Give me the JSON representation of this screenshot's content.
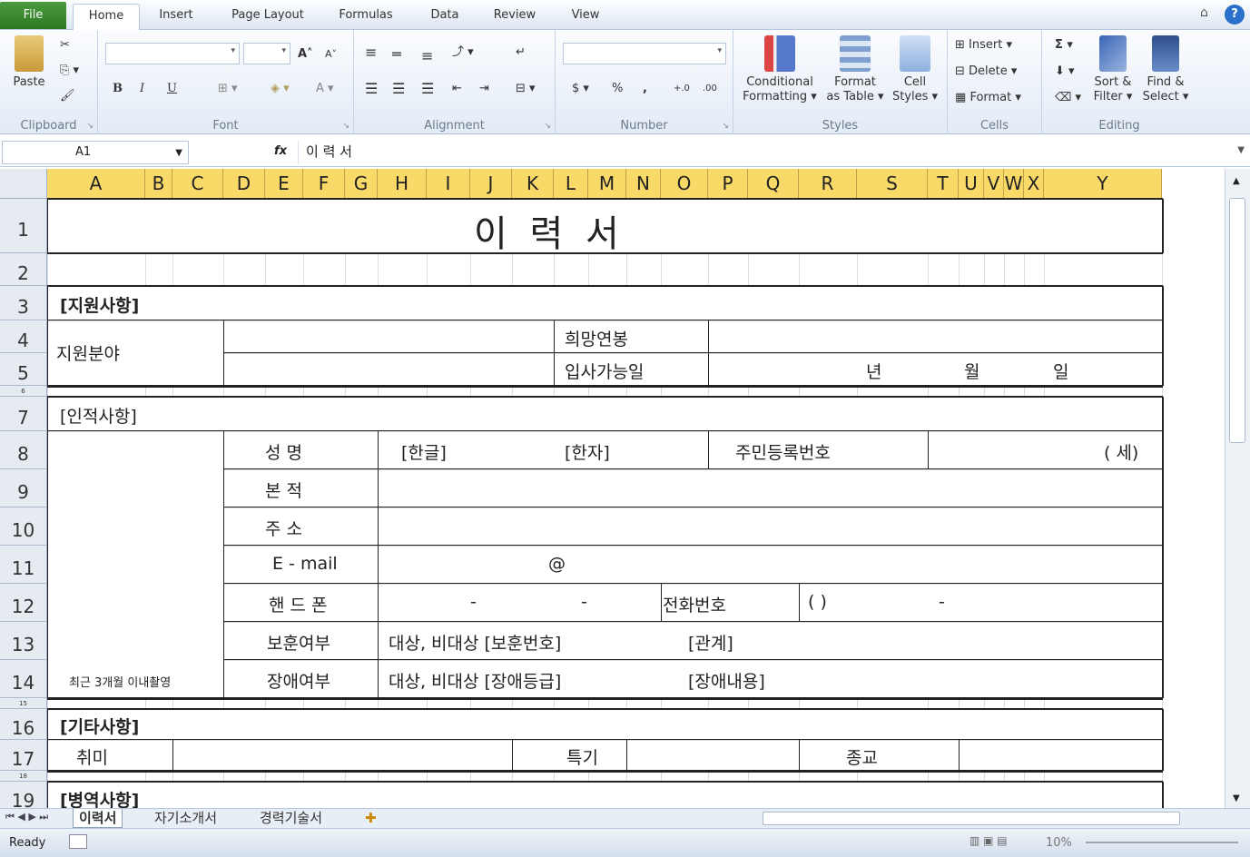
{
  "ribbon_tabs": {
    "file": "File",
    "home": "Home",
    "insert": "Insert",
    "page_layout": "Page Layout",
    "formulas": "Formulas",
    "data": "Data",
    "review": "Review",
    "view": "View"
  },
  "window": {
    "help": "?",
    "minimize": "⌂"
  },
  "clipboard": {
    "paste": "Paste",
    "label": "Clipboard"
  },
  "font_group": {
    "label": "Font",
    "bold": "B",
    "italic": "I",
    "underline": "U",
    "grow": "A˄",
    "shrink": "A˅",
    "color": "A"
  },
  "alignment": {
    "label": "Alignment"
  },
  "number_group": {
    "label": "Number",
    "currency": "$",
    "percent": "%",
    "comma": ","
  },
  "styles": {
    "label": "Styles",
    "conditional_1": "Conditional",
    "conditional_2": "Formatting ▾",
    "format_table_1": "Format",
    "format_table_2": "as Table ▾",
    "cell_styles_1": "Cell",
    "cell_styles_2": "Styles ▾"
  },
  "cells_group": {
    "label": "Cells",
    "insert": "Insert ▾",
    "delete": "Delete ▾",
    "format": "Format ▾"
  },
  "editing": {
    "label": "Editing",
    "sigma": "Σ ▾",
    "sort_1": "Sort &",
    "sort_2": "Filter ▾",
    "find_1": "Find &",
    "find_2": "Select ▾"
  },
  "formula_bar": {
    "name_box": "A1",
    "fx": "fx",
    "formula": "이 력 서"
  },
  "columns": [
    "A",
    "B",
    "C",
    "D",
    "E",
    "F",
    "G",
    "H",
    "I",
    "J",
    "K",
    "L",
    "M",
    "N",
    "O",
    "P",
    "Q",
    "R",
    "S",
    "T",
    "U",
    "V",
    "W",
    "X",
    "Y"
  ],
  "rows": [
    "1",
    "2",
    "3",
    "4",
    "5",
    "6",
    "7",
    "8",
    "9",
    "10",
    "11",
    "12",
    "13",
    "14",
    "15",
    "16",
    "17",
    "18",
    "19"
  ],
  "sheet": {
    "title": "이   력   서",
    "sec_apply": "[지원사항]",
    "apply_field": "지원분야",
    "desired_salary": "희망연봉",
    "start_date": "입사가능일",
    "year": "년",
    "month": "월",
    "day": "일",
    "sec_personal": "[인적사항]",
    "name": "성    명",
    "korean": "[한글]",
    "hanja": "[한자]",
    "resident_no": "주민등록번호",
    "age": "(   세)",
    "origin": "본    적",
    "address": "주    소",
    "email": "E - mail",
    "at": "@",
    "mobile": "핸 드 폰",
    "dash1": "-",
    "dash2": "-",
    "phone": "전화번호",
    "phone_paren": "(        )",
    "dash3": "-",
    "veteran": "보훈여부",
    "veteran_val": "대상, 비대상  [보훈번호]",
    "relation": "[관계]",
    "disability": "장애여부",
    "disability_val": "대상, 비대상  [장애등급]",
    "disability_detail": "[장애내용]",
    "photo_note": "최근 3개월 이내촬영",
    "sec_other": "[기타사항]",
    "hobby": "취미",
    "specialty": "특기",
    "religion": "종교",
    "sec_military": "[병역사항]"
  },
  "sheet_tabs": [
    "이력서",
    "자기소개서",
    "경력기술서"
  ],
  "status": {
    "ready": "Ready",
    "zoom": "10%"
  }
}
